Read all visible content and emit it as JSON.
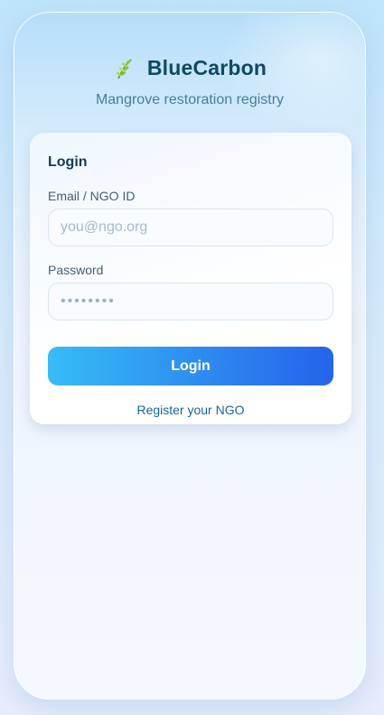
{
  "app": {
    "title": "BlueCarbon",
    "subtitle": "Mangrove restoration registry",
    "logo_icon": "leaf-icon"
  },
  "login_card": {
    "title": "Login",
    "email": {
      "label": "Email / NGO ID",
      "placeholder": "you@ngo.org",
      "value": ""
    },
    "password": {
      "label": "Password",
      "placeholder": "••••••••",
      "value": ""
    },
    "submit_label": "Login",
    "register_link": "Register your NGO"
  },
  "colors": {
    "brand_dark": "#0e4a63",
    "accent_start": "#36bdf6",
    "accent_end": "#2563eb",
    "link": "#16688f"
  }
}
